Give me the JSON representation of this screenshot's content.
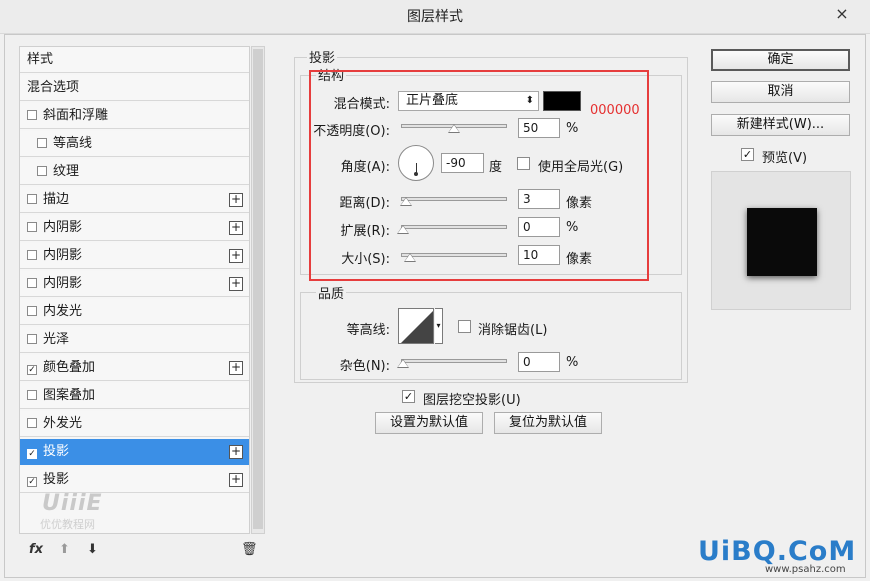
{
  "window": {
    "title": "图层样式",
    "close_glyph": "×"
  },
  "sidebar": {
    "items": [
      {
        "label": "样式",
        "checkbox": false,
        "checked": false,
        "plus": false,
        "indent": false
      },
      {
        "label": "混合选项",
        "checkbox": false,
        "checked": false,
        "plus": false,
        "indent": false
      },
      {
        "label": "斜面和浮雕",
        "checkbox": true,
        "checked": false,
        "plus": false,
        "indent": false
      },
      {
        "label": "等高线",
        "checkbox": true,
        "checked": false,
        "plus": false,
        "indent": true
      },
      {
        "label": "纹理",
        "checkbox": true,
        "checked": false,
        "plus": false,
        "indent": true
      },
      {
        "label": "描边",
        "checkbox": true,
        "checked": false,
        "plus": true,
        "indent": false
      },
      {
        "label": "内阴影",
        "checkbox": true,
        "checked": false,
        "plus": true,
        "indent": false
      },
      {
        "label": "内阴影",
        "checkbox": true,
        "checked": false,
        "plus": true,
        "indent": false
      },
      {
        "label": "内阴影",
        "checkbox": true,
        "checked": false,
        "plus": true,
        "indent": false
      },
      {
        "label": "内发光",
        "checkbox": true,
        "checked": false,
        "plus": false,
        "indent": false
      },
      {
        "label": "光泽",
        "checkbox": true,
        "checked": false,
        "plus": false,
        "indent": false
      },
      {
        "label": "颜色叠加",
        "checkbox": true,
        "checked": true,
        "plus": true,
        "indent": false
      },
      {
        "label": "图案叠加",
        "checkbox": true,
        "checked": false,
        "plus": false,
        "indent": false
      },
      {
        "label": "外发光",
        "checkbox": true,
        "checked": false,
        "plus": false,
        "indent": false
      },
      {
        "label": "投影",
        "checkbox": true,
        "checked": true,
        "plus": true,
        "indent": false,
        "selected": true
      },
      {
        "label": "投影",
        "checkbox": true,
        "checked": true,
        "plus": true,
        "indent": false
      }
    ],
    "footer": {
      "fx": "fx",
      "up_glyph": "⬆",
      "down_glyph": "⬇",
      "trash_glyph": "🗑"
    },
    "watermark": {
      "brand": "UiiiE",
      "site": "优优教程网"
    }
  },
  "shadow": {
    "section_title": "投影",
    "structure_title": "结构",
    "blend_mode_label": "混合模式:",
    "blend_mode_value": "正片叠底",
    "color_hex_annotation": "000000",
    "color": "#000000",
    "opacity_label": "不透明度(O):",
    "opacity_value": "50",
    "opacity_unit": "%",
    "opacity_fraction": 0.5,
    "angle_label": "角度(A):",
    "angle_value": "-90",
    "angle_unit": "度",
    "global_light_label": "使用全局光(G)",
    "global_light_checked": false,
    "distance_label": "距离(D):",
    "distance_value": "3",
    "distance_unit": "像素",
    "spread_label": "扩展(R):",
    "spread_value": "0",
    "spread_unit": "%",
    "size_label": "大小(S):",
    "size_value": "10",
    "size_unit": "像素"
  },
  "quality": {
    "title": "品质",
    "contour_label": "等高线:",
    "anti_alias_label": "消除锯齿(L)",
    "anti_alias_checked": false,
    "noise_label": "杂色(N):",
    "noise_value": "0",
    "noise_unit": "%"
  },
  "knockout": {
    "label": "图层挖空投影(U)",
    "checked": true
  },
  "default_buttons": {
    "set_default": "设置为默认值",
    "reset_default": "复位为默认值"
  },
  "right_panel": {
    "ok": "确定",
    "cancel": "取消",
    "new_style": "新建样式(W)...",
    "preview_label": "预览(V)",
    "preview_checked": true
  },
  "branding": {
    "logo": "UiBQ.CoM",
    "url": "www.psahz.com"
  },
  "colors": {
    "selection": "#3b8fe6",
    "highlight_box": "#e63d3d",
    "hex_text": "#e53030"
  }
}
